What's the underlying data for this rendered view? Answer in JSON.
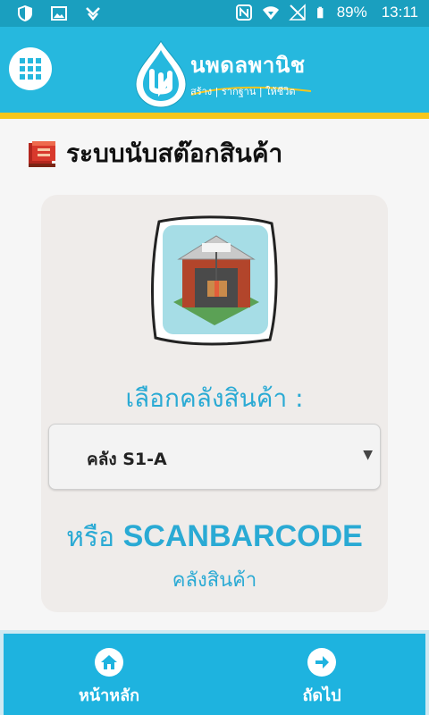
{
  "statusbar": {
    "battery": "89%",
    "time": "13:11"
  },
  "header": {
    "brand_name": "นพดลพานิช",
    "brand_tagline": "สร้าง | รากฐาน | ให้ชีวิต",
    "brand_color": "#26b8de",
    "stripe_color": "#f6c61c"
  },
  "page": {
    "title": "ระบบนับสต๊อกสินค้า"
  },
  "form": {
    "select_label": "เลือกคลังสินค้า :",
    "selected_value": "คลัง S1-A",
    "arrow": "▼",
    "or_prefix": "หรือ ",
    "or_scan": "SCANBARCODE",
    "or_sub": "คลังสินค้า"
  },
  "nav": {
    "home_label": "หน้าหลัก",
    "next_label": "ถัดไป"
  }
}
